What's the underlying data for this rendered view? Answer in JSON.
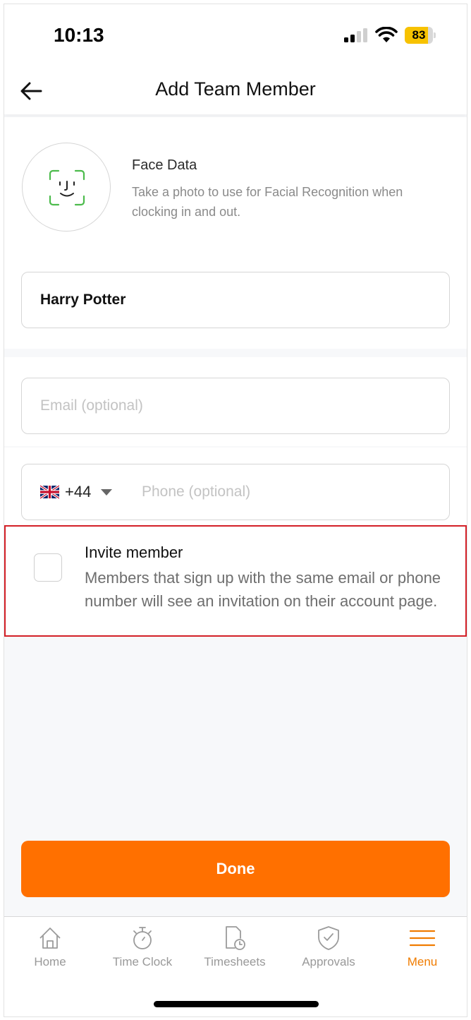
{
  "status_bar": {
    "time": "10:13",
    "battery_percent": "83",
    "battery_level": 0.83,
    "signal_bars_active": 2,
    "signal_bars_total": 4
  },
  "header": {
    "title": "Add Team Member",
    "back_icon": "arrow-left-icon"
  },
  "face_data": {
    "title": "Face Data",
    "description": "Take a photo to use for Facial Recognition when clocking in and out.",
    "icon": "face-id-icon",
    "icon_color": "#4cbb4c"
  },
  "form": {
    "name_value": "Harry Potter",
    "email_value": "",
    "email_placeholder": "Email (optional)",
    "country_code": "+44",
    "country_flag": "uk-flag-icon",
    "phone_value": "",
    "phone_placeholder": "Phone (optional)"
  },
  "invite": {
    "checked": false,
    "title": "Invite member",
    "description": "Members that sign up with the same email or phone number will see an invitation on their account page."
  },
  "done_button": {
    "label": "Done",
    "color": "#ff7000"
  },
  "tab_bar": {
    "active_color": "#f07c00",
    "inactive_color": "#999999",
    "items": [
      {
        "label": "Home",
        "icon": "home-icon",
        "active": false
      },
      {
        "label": "Time Clock",
        "icon": "stopwatch-icon",
        "active": false
      },
      {
        "label": "Timesheets",
        "icon": "timesheet-icon",
        "active": false
      },
      {
        "label": "Approvals",
        "icon": "shield-check-icon",
        "active": false
      },
      {
        "label": "Menu",
        "icon": "menu-icon",
        "active": true
      }
    ]
  }
}
